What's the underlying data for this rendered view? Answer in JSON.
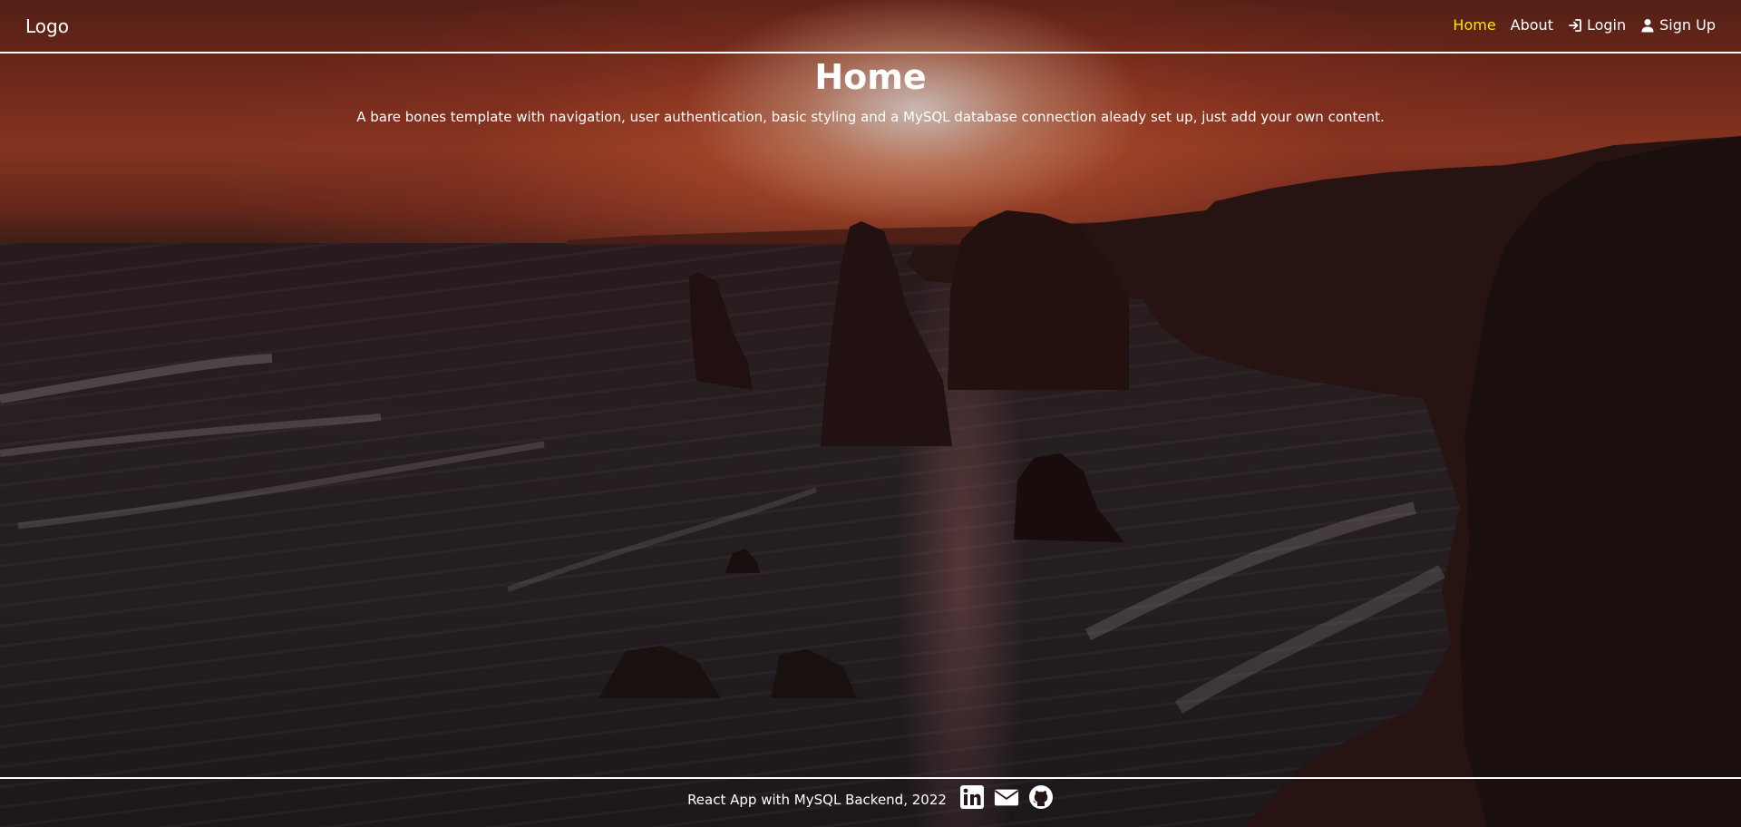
{
  "navbar": {
    "logo": "Logo",
    "links": [
      {
        "label": "Home",
        "icon": null,
        "active": true
      },
      {
        "label": "About",
        "icon": null,
        "active": false
      },
      {
        "label": "Login",
        "icon": "login-icon",
        "active": false
      },
      {
        "label": "Sign Up",
        "icon": "user-icon",
        "active": false
      }
    ]
  },
  "main": {
    "title": "Home",
    "description": "A bare bones template with navigation, user authentication, basic styling and a MySQL database connection aleady set up, just add your own content."
  },
  "footer": {
    "text": "React App with MySQL Backend, 2022",
    "icons": [
      "linkedin-icon",
      "mail-icon",
      "github-icon"
    ]
  },
  "colors": {
    "active_link": "#ffe600",
    "text": "#ffffff",
    "divider": "#ffffff"
  }
}
